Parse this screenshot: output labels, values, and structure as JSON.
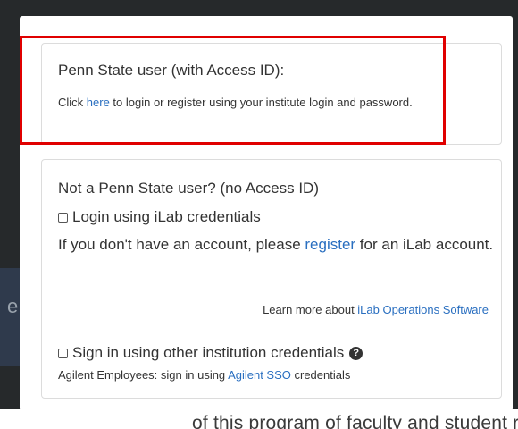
{
  "backdrop": {
    "left_glyph": "e",
    "bottom_text": "of this program of faculty and student research and creative"
  },
  "penn_state": {
    "heading": "Penn State user (with Access ID):",
    "prefix": "Click ",
    "link": "here",
    "suffix": " to login or register using your institute login and password."
  },
  "not_penn": {
    "heading": "Not a Penn State user? (no Access ID)",
    "ilab_checkbox_label": "Login using iLab credentials",
    "account_prefix": "If you don't have an account, please ",
    "register_link": "register",
    "account_suffix": " for an iLab account.",
    "learn_prefix": "Learn more about ",
    "learn_link": "iLab Operations Software",
    "other_checkbox_label": "Sign in using other institution credentials",
    "help_icon_glyph": "?",
    "agilent_prefix": "Agilent Employees: sign in using ",
    "agilent_link": "Agilent SSO",
    "agilent_suffix": " credentials"
  },
  "colors": {
    "highlight": "#e00000",
    "link": "#2a6fc0"
  }
}
